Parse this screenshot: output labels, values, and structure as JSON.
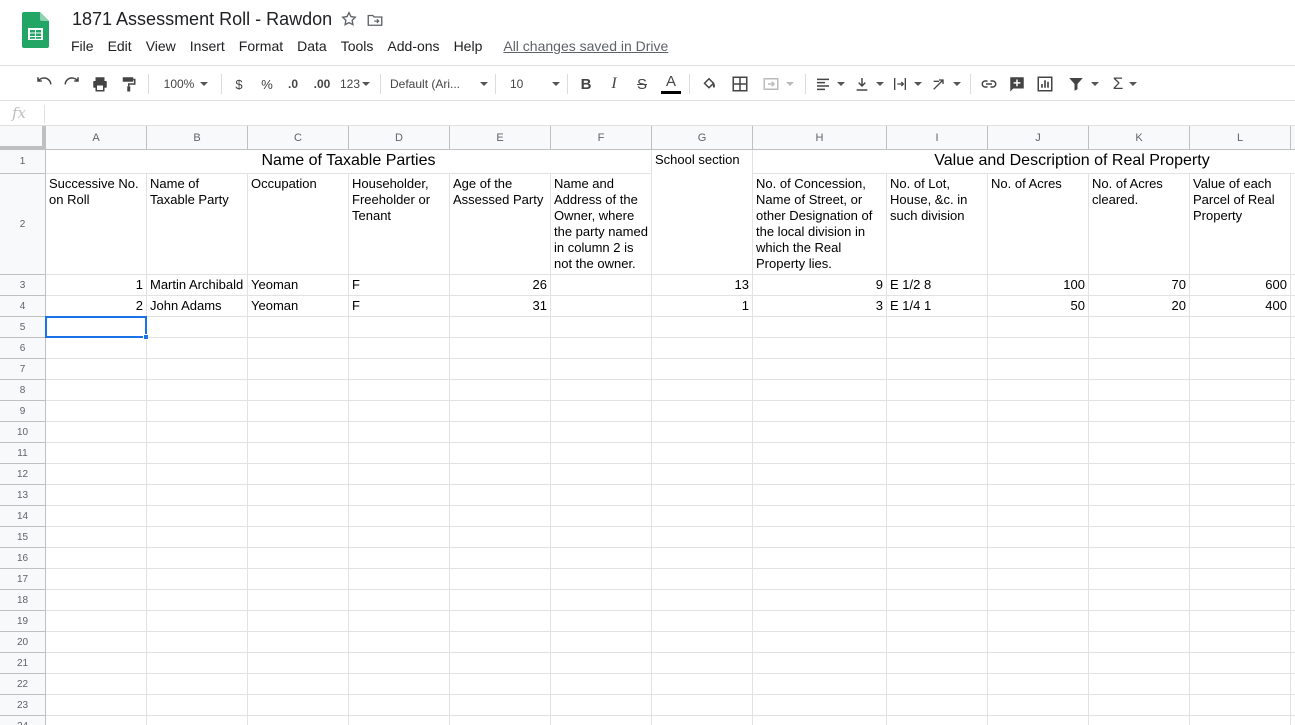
{
  "document": {
    "title": "1871 Assessment Roll - Rawdon",
    "save_status": "All changes saved in Drive"
  },
  "menu": [
    "File",
    "Edit",
    "View",
    "Insert",
    "Format",
    "Data",
    "Tools",
    "Add-ons",
    "Help"
  ],
  "toolbar": {
    "zoom": "100%",
    "currency": "$",
    "percent": "%",
    "decrease_decimal": ".0",
    "increase_decimal": ".00",
    "number_format": "123",
    "font": "Default (Ari...",
    "font_size": "10",
    "bold": "B",
    "italic": "I",
    "strike": "S",
    "text_color": "A",
    "function": "Σ"
  },
  "formula_bar": {
    "icon": "fx",
    "value": ""
  },
  "columns": [
    "A",
    "B",
    "C",
    "D",
    "E",
    "F",
    "G",
    "H",
    "I",
    "J",
    "K",
    "L"
  ],
  "rows": [
    "1",
    "2",
    "3",
    "4",
    "5",
    "6",
    "7",
    "8",
    "9",
    "10",
    "11",
    "12",
    "13",
    "14",
    "15",
    "16",
    "17",
    "18",
    "19",
    "20",
    "21",
    "22",
    "23",
    "24"
  ],
  "cells": {
    "r1": {
      "taxable_parties": "Name of Taxable Parties",
      "school_section": "School section",
      "real_property": "Value and Description of Real Property"
    },
    "r2": {
      "A": "Successive No. on Roll",
      "B": "Name of Taxable Party",
      "C": "Occupation",
      "D": "Householder, Freeholder or Tenant",
      "E": "Age of the Assessed Party",
      "F": "Name and Address of the Owner, where the party named in column 2 is not the owner.",
      "H": "No. of Concession, Name of Street, or other Designation of the local division in which the Real Property lies.",
      "I": "No. of Lot, House, &c. in such division",
      "J": "No. of Acres",
      "K": "No. of Acres cleared.",
      "L": "Value of each Parcel of Real Property"
    },
    "r3": {
      "A": "1",
      "B": "Martin Archibald",
      "C": "Yeoman",
      "D": "F",
      "E": "26",
      "F": "",
      "G": "13",
      "H": "9",
      "I": "E 1/2 8",
      "J": "100",
      "K": "70",
      "L": "600"
    },
    "r4": {
      "A": "2",
      "B": "John Adams",
      "C": "Yeoman",
      "D": "F",
      "E": "31",
      "F": "",
      "G": "1",
      "H": "3",
      "I": "E 1/4 1",
      "J": "50",
      "K": "20",
      "L": "400"
    }
  },
  "selected_cell": "A5",
  "colors": {
    "selection": "#1a73e8",
    "sheets_green": "#23a566"
  }
}
